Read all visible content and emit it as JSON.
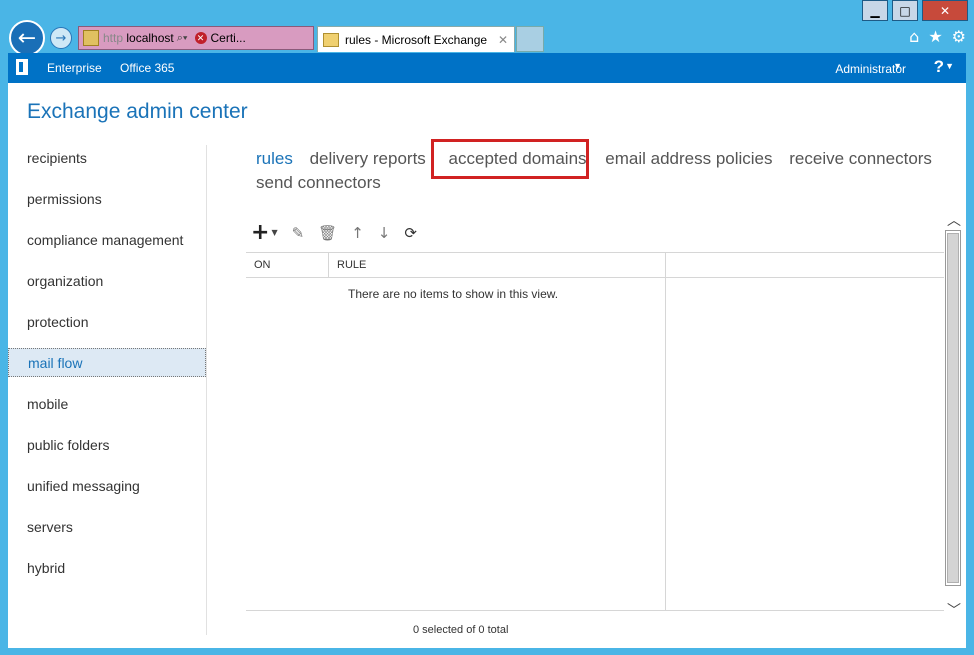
{
  "window": {
    "minimize": "▁",
    "maximize": "□",
    "close": "✕"
  },
  "browser": {
    "address_prefix": "http",
    "host": "localhost",
    "cert_label": "Certi...",
    "tab_title": "rules - Microsoft Exchange",
    "tab_close": "✕"
  },
  "topbar": {
    "links": [
      "Enterprise",
      "Office 365"
    ],
    "user": "Administrator",
    "help": "?"
  },
  "page": {
    "title": "Exchange admin center"
  },
  "leftnav": {
    "items": [
      "recipients",
      "permissions",
      "compliance management",
      "organization",
      "protection",
      "mail flow",
      "mobile",
      "public folders",
      "unified messaging",
      "servers",
      "hybrid"
    ],
    "selected": "mail flow"
  },
  "subnav": {
    "tabs": [
      "rules",
      "delivery reports",
      "accepted domains",
      "email address policies",
      "receive connectors",
      "send connectors"
    ],
    "active": "rules",
    "highlighted": "accepted domains"
  },
  "toolbar": {
    "icons": [
      "add-icon",
      "edit-icon",
      "delete-icon",
      "move-up-icon",
      "move-down-icon",
      "refresh-icon"
    ]
  },
  "grid": {
    "columns": [
      "ON",
      "RULE"
    ],
    "empty_text": "There are no items to show in this view.",
    "status": "0 selected of 0 total"
  },
  "colors": {
    "brand": "#0072c6",
    "accent_text": "#1a73b8",
    "highlight_border": "#d12222"
  }
}
